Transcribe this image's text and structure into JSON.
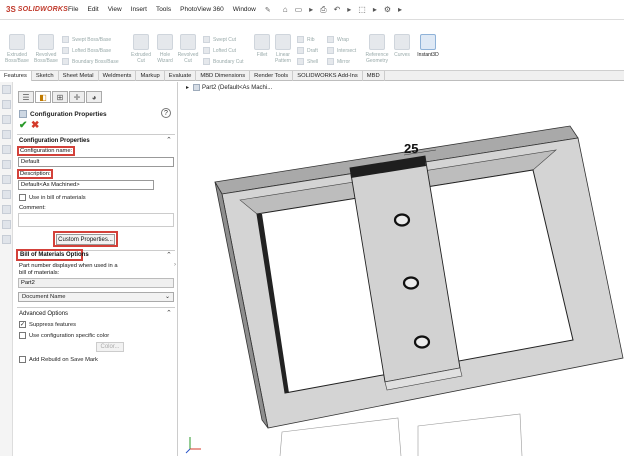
{
  "app": {
    "logo_ds": "3S",
    "logo_text": "SOLIDWORKS"
  },
  "menu": [
    "File",
    "Edit",
    "View",
    "Insert",
    "Tools",
    "PhotoView 360",
    "Window"
  ],
  "quick_access": [
    "⌂",
    "▭",
    "▸",
    "⎙",
    "↶",
    "▸",
    "⬚",
    "▸",
    "⚙",
    "▸"
  ],
  "ribbon": {
    "extruded_boss": "Extruded Boss/Base",
    "revolved_boss": "Revolved Boss/Base",
    "swept_boss": "Swept Boss/Base",
    "lofted_boss": "Lofted Boss/Base",
    "boundary_boss": "Boundary Boss/Base",
    "extruded_cut": "Extruded Cut",
    "hole_wizard": "Hole Wizard",
    "revolved_cut": "Revolved Cut",
    "swept_cut": "Swept Cut",
    "lofted_cut": "Lofted Cut",
    "boundary_cut": "Boundary Cut",
    "fillet": "Fillet",
    "linear_pattern": "Linear Pattern",
    "rib": "Rib",
    "draft": "Draft",
    "shell": "Shell",
    "wrap": "Wrap",
    "intersect": "Intersect",
    "mirror": "Mirror",
    "reference_geometry": "Reference Geometry",
    "curves": "Curves",
    "instant3d": "Instant3D"
  },
  "tabs": [
    "Features",
    "Sketch",
    "Sheet Metal",
    "Weldments",
    "Markup",
    "Evaluate",
    "MBD Dimensions",
    "Render Tools",
    "SOLIDWORKS Add-Ins",
    "MBD"
  ],
  "pm": {
    "title": "Configuration Properties",
    "help": "?",
    "ok": "✔",
    "cancel": "✖",
    "section1": "Configuration Properties",
    "config_name_label": "Configuration name:",
    "config_name_value": "Default",
    "description_label": "Description:",
    "description_value": "Default<As Machined>",
    "use_in_bom": "Use in bill of materials",
    "comment_label": "Comment:",
    "custom_properties": "Custom Properties...",
    "bom_section": "Bill of Materials Options",
    "part_number_label": "Part number displayed when used in a bill of materials:",
    "part_number_value": "Part2",
    "document_name": "Document Name",
    "advanced_section": "Advanced Options",
    "suppress_features": "Suppress features",
    "use_config_color": "Use configuration specific color",
    "color_button": "Color...",
    "add_rebuild": "Add Rebuild on Save Mark"
  },
  "tree": {
    "label": "Part2  (Default<As Machi..."
  },
  "annotation": {
    "dimension": "25"
  }
}
